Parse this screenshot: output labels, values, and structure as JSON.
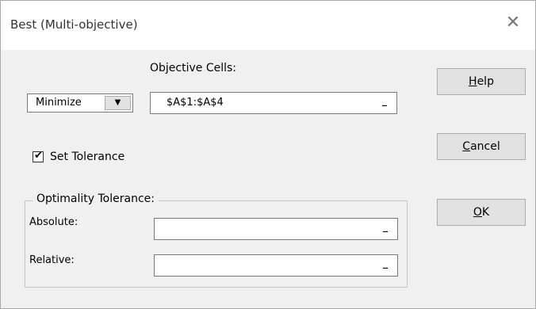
{
  "window": {
    "title": "Best (Multi-objective)",
    "close_glyph": "✕"
  },
  "objective": {
    "label": "Objective Cells:",
    "mode_value": "Minimize",
    "mode_arrow": "▼",
    "cells_value": "$A$1:$A$4",
    "refedit_glyph": "_"
  },
  "tolerance": {
    "checkbox_label": "Set Tolerance",
    "checked": true,
    "check_glyph": "✔"
  },
  "optimality": {
    "group_label": "Optimality Tolerance:",
    "absolute_label": "Absolute:",
    "absolute_value": "",
    "relative_label": "Relative:",
    "relative_value": ""
  },
  "buttons": {
    "help": {
      "hotkey": "H",
      "rest": "elp"
    },
    "cancel": {
      "hotkey": "C",
      "rest": "ancel"
    },
    "ok": {
      "hotkey": "O",
      "rest": "K"
    }
  }
}
